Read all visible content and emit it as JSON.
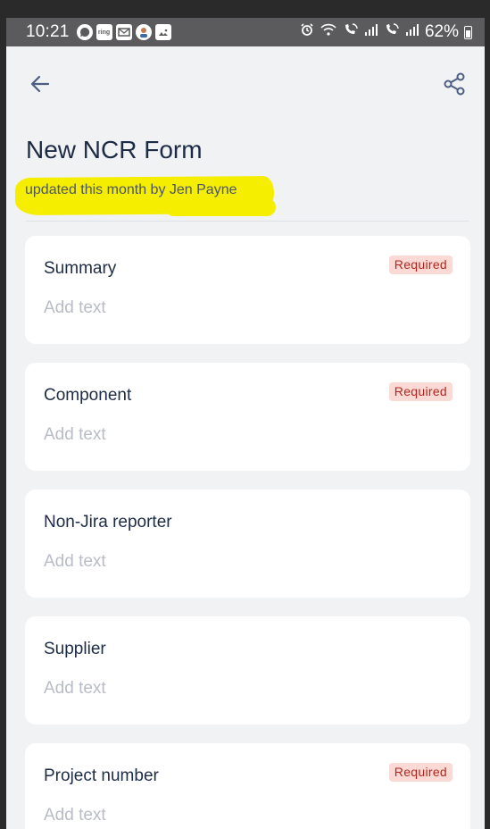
{
  "status_bar": {
    "time": "10:21",
    "battery": "62%",
    "left_icons": [
      "whatsapp-icon",
      "ring-icon",
      "outlook-icon",
      "avatar-notification-icon",
      "gallery-icon"
    ],
    "ring_label": "ring",
    "right_icons": [
      "alarm-icon",
      "wifi-icon",
      "wifi-call-icon",
      "signal-icon",
      "wifi-call-icon",
      "signal-icon"
    ]
  },
  "header": {
    "back_icon": "arrow-left-icon",
    "share_icon": "share-icon"
  },
  "page": {
    "title": "New NCR Form",
    "subtitle": "updated this month by Jen Payne"
  },
  "colors": {
    "title": "#1d2b45",
    "highlight": "#f5ee00",
    "badge_bg": "#fbd9d5",
    "badge_text": "#b3271e",
    "background": "#f1f2f4"
  },
  "fields": [
    {
      "label": "Summary",
      "placeholder": "Add text",
      "required": true,
      "badge": "Required"
    },
    {
      "label": "Component",
      "placeholder": "Add text",
      "required": true,
      "badge": "Required"
    },
    {
      "label": "Non-Jira reporter",
      "placeholder": "Add text",
      "required": false,
      "badge": ""
    },
    {
      "label": "Supplier",
      "placeholder": "Add text",
      "required": false,
      "badge": ""
    },
    {
      "label": "Project number",
      "placeholder": "Add text",
      "required": true,
      "badge": "Required"
    }
  ]
}
